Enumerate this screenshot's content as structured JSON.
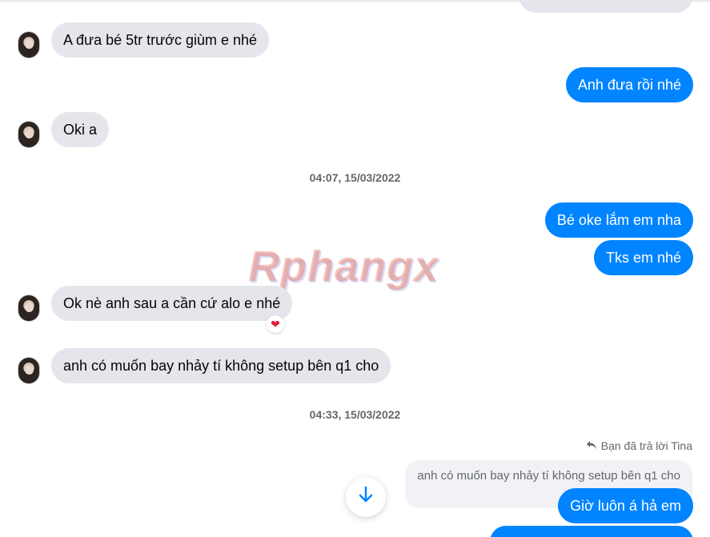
{
  "messages": {
    "m1": "A đưa bé 5tr trước giùm e nhé",
    "m2": "Anh đưa rồi nhé",
    "m3": "Oki a",
    "m4": "Bé oke lắm em nha",
    "m5": "Tks em nhé",
    "m6": "Ok nè anh sau a cần cứ alo e nhé",
    "m7": "anh có muốn bay nhảy tí không setup bên q1 cho",
    "m8": "Giờ luôn á hả em"
  },
  "timestamps": {
    "t1": "04:07, 15/03/2022",
    "t2": "04:33, 15/03/2022"
  },
  "reply": {
    "label": "Bạn đã trả lời Tina",
    "quote": "anh có muốn bay nhảy tí không setup bên q1 cho"
  },
  "reaction": "❤",
  "watermark": "Rphangx",
  "icons": {
    "reply": "reply-arrow-icon",
    "scroll": "arrow-down-icon",
    "reaction": "heart-icon"
  },
  "colors": {
    "outgoing": "#0084ff",
    "incoming": "#e4e6eb"
  }
}
